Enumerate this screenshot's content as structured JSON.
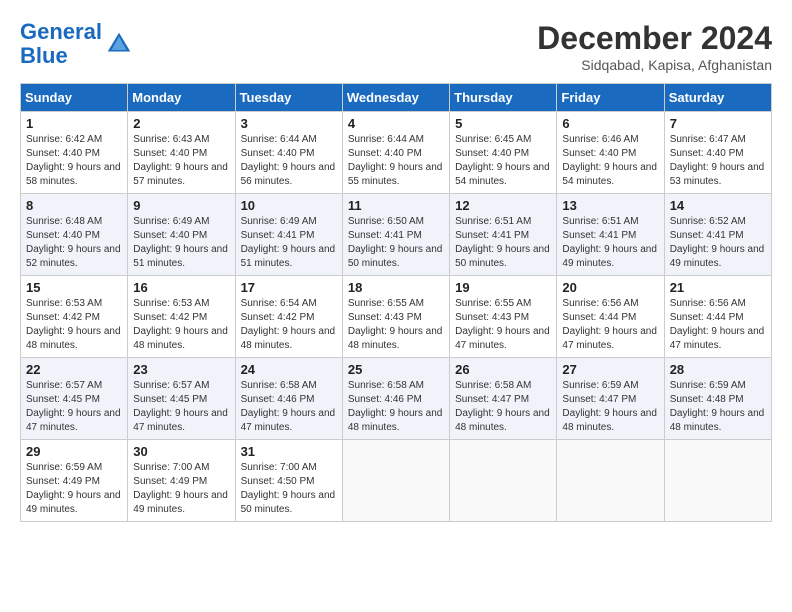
{
  "header": {
    "logo_line1": "General",
    "logo_line2": "Blue",
    "month_title": "December 2024",
    "location": "Sidqabad, Kapisa, Afghanistan"
  },
  "days_of_week": [
    "Sunday",
    "Monday",
    "Tuesday",
    "Wednesday",
    "Thursday",
    "Friday",
    "Saturday"
  ],
  "weeks": [
    [
      {
        "day": "1",
        "sunrise": "6:42 AM",
        "sunset": "4:40 PM",
        "daylight": "9 hours and 58 minutes."
      },
      {
        "day": "2",
        "sunrise": "6:43 AM",
        "sunset": "4:40 PM",
        "daylight": "9 hours and 57 minutes."
      },
      {
        "day": "3",
        "sunrise": "6:44 AM",
        "sunset": "4:40 PM",
        "daylight": "9 hours and 56 minutes."
      },
      {
        "day": "4",
        "sunrise": "6:44 AM",
        "sunset": "4:40 PM",
        "daylight": "9 hours and 55 minutes."
      },
      {
        "day": "5",
        "sunrise": "6:45 AM",
        "sunset": "4:40 PM",
        "daylight": "9 hours and 54 minutes."
      },
      {
        "day": "6",
        "sunrise": "6:46 AM",
        "sunset": "4:40 PM",
        "daylight": "9 hours and 54 minutes."
      },
      {
        "day": "7",
        "sunrise": "6:47 AM",
        "sunset": "4:40 PM",
        "daylight": "9 hours and 53 minutes."
      }
    ],
    [
      {
        "day": "8",
        "sunrise": "6:48 AM",
        "sunset": "4:40 PM",
        "daylight": "9 hours and 52 minutes."
      },
      {
        "day": "9",
        "sunrise": "6:49 AM",
        "sunset": "4:40 PM",
        "daylight": "9 hours and 51 minutes."
      },
      {
        "day": "10",
        "sunrise": "6:49 AM",
        "sunset": "4:41 PM",
        "daylight": "9 hours and 51 minutes."
      },
      {
        "day": "11",
        "sunrise": "6:50 AM",
        "sunset": "4:41 PM",
        "daylight": "9 hours and 50 minutes."
      },
      {
        "day": "12",
        "sunrise": "6:51 AM",
        "sunset": "4:41 PM",
        "daylight": "9 hours and 50 minutes."
      },
      {
        "day": "13",
        "sunrise": "6:51 AM",
        "sunset": "4:41 PM",
        "daylight": "9 hours and 49 minutes."
      },
      {
        "day": "14",
        "sunrise": "6:52 AM",
        "sunset": "4:41 PM",
        "daylight": "9 hours and 49 minutes."
      }
    ],
    [
      {
        "day": "15",
        "sunrise": "6:53 AM",
        "sunset": "4:42 PM",
        "daylight": "9 hours and 48 minutes."
      },
      {
        "day": "16",
        "sunrise": "6:53 AM",
        "sunset": "4:42 PM",
        "daylight": "9 hours and 48 minutes."
      },
      {
        "day": "17",
        "sunrise": "6:54 AM",
        "sunset": "4:42 PM",
        "daylight": "9 hours and 48 minutes."
      },
      {
        "day": "18",
        "sunrise": "6:55 AM",
        "sunset": "4:43 PM",
        "daylight": "9 hours and 48 minutes."
      },
      {
        "day": "19",
        "sunrise": "6:55 AM",
        "sunset": "4:43 PM",
        "daylight": "9 hours and 47 minutes."
      },
      {
        "day": "20",
        "sunrise": "6:56 AM",
        "sunset": "4:44 PM",
        "daylight": "9 hours and 47 minutes."
      },
      {
        "day": "21",
        "sunrise": "6:56 AM",
        "sunset": "4:44 PM",
        "daylight": "9 hours and 47 minutes."
      }
    ],
    [
      {
        "day": "22",
        "sunrise": "6:57 AM",
        "sunset": "4:45 PM",
        "daylight": "9 hours and 47 minutes."
      },
      {
        "day": "23",
        "sunrise": "6:57 AM",
        "sunset": "4:45 PM",
        "daylight": "9 hours and 47 minutes."
      },
      {
        "day": "24",
        "sunrise": "6:58 AM",
        "sunset": "4:46 PM",
        "daylight": "9 hours and 47 minutes."
      },
      {
        "day": "25",
        "sunrise": "6:58 AM",
        "sunset": "4:46 PM",
        "daylight": "9 hours and 48 minutes."
      },
      {
        "day": "26",
        "sunrise": "6:58 AM",
        "sunset": "4:47 PM",
        "daylight": "9 hours and 48 minutes."
      },
      {
        "day": "27",
        "sunrise": "6:59 AM",
        "sunset": "4:47 PM",
        "daylight": "9 hours and 48 minutes."
      },
      {
        "day": "28",
        "sunrise": "6:59 AM",
        "sunset": "4:48 PM",
        "daylight": "9 hours and 48 minutes."
      }
    ],
    [
      {
        "day": "29",
        "sunrise": "6:59 AM",
        "sunset": "4:49 PM",
        "daylight": "9 hours and 49 minutes."
      },
      {
        "day": "30",
        "sunrise": "7:00 AM",
        "sunset": "4:49 PM",
        "daylight": "9 hours and 49 minutes."
      },
      {
        "day": "31",
        "sunrise": "7:00 AM",
        "sunset": "4:50 PM",
        "daylight": "9 hours and 50 minutes."
      },
      null,
      null,
      null,
      null
    ]
  ],
  "labels": {
    "sunrise_prefix": "Sunrise: ",
    "sunset_prefix": "Sunset: ",
    "daylight_prefix": "Daylight: "
  }
}
